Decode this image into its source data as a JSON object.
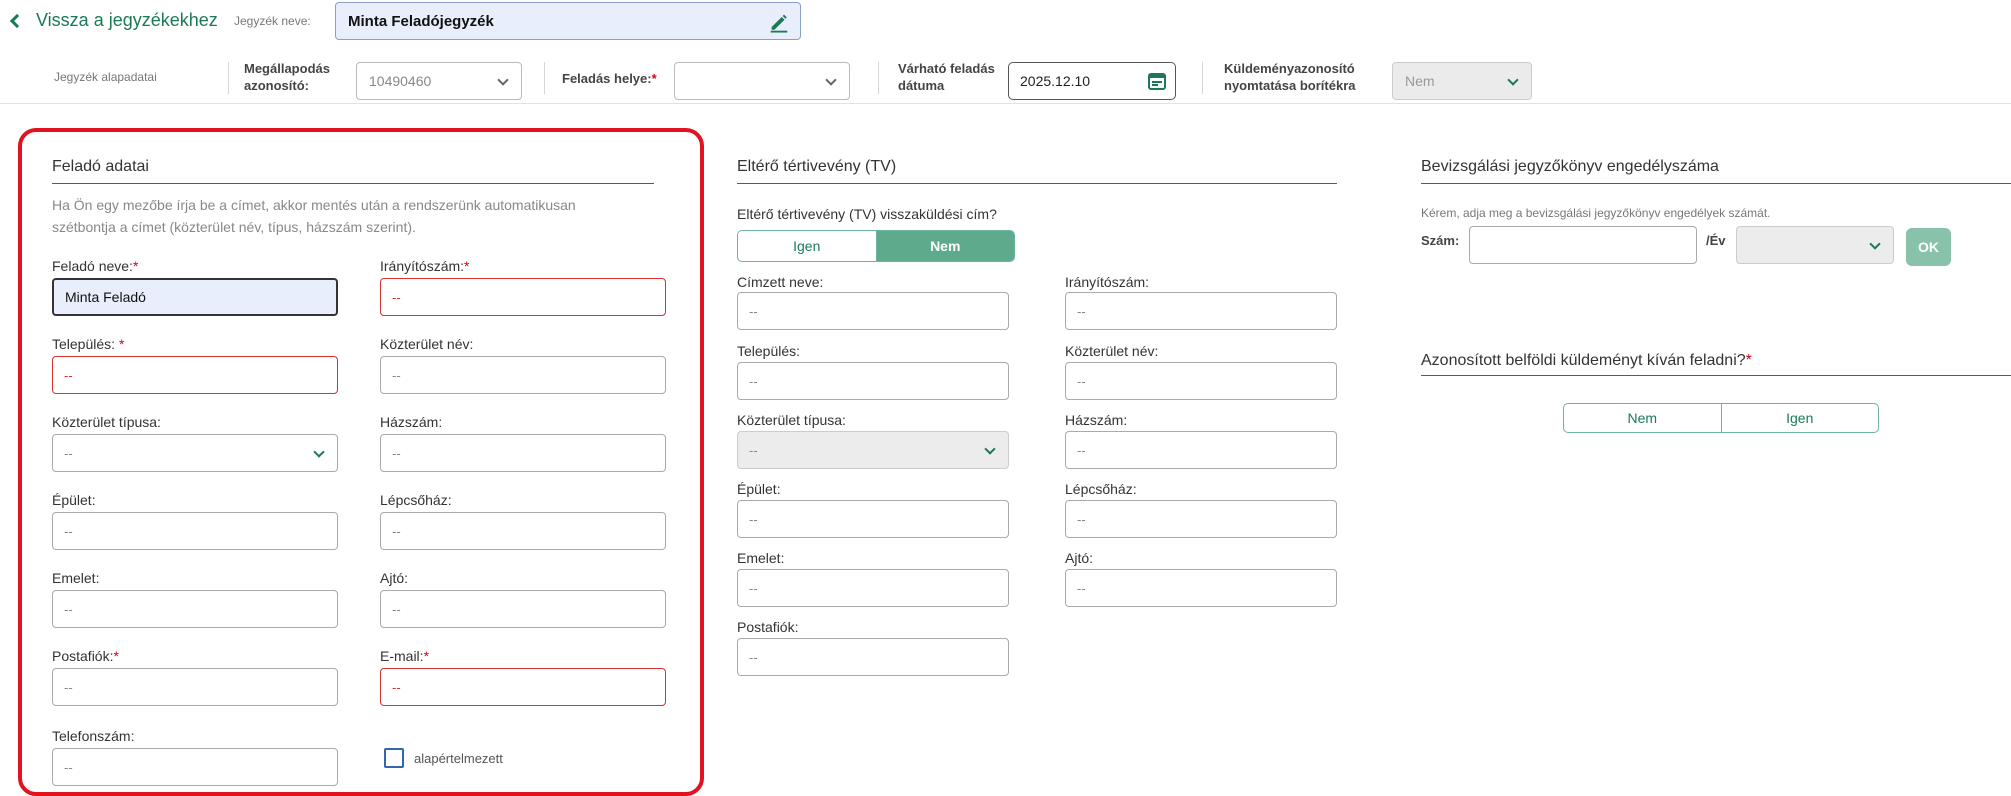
{
  "header": {
    "back_label": "Vissza a jegyzékekhez",
    "list_name_label": "Jegyzék neve:",
    "list_name_value": "Minta Feladójegyzék"
  },
  "toolbar": {
    "basic_data_label": "Jegyzék alapadatai",
    "agreement_label_1": "Megállapodás",
    "agreement_label_2": "azonosító:",
    "agreement_value": "10490460",
    "place_label": "Feladás helye:",
    "place_required": "*",
    "place_value": "",
    "date_label_1": "Várható feladás",
    "date_label_2": "dátuma",
    "date_value": "2025.12.10",
    "print_label_1": "Küldeményazonosító",
    "print_label_2": "nyomtatása borítékra",
    "print_value": "Nem"
  },
  "sender": {
    "title": "Feladó adatai",
    "hint_1": "Ha Ön egy mezőbe írja be a címet, akkor mentés után a rendszerünk automatikusan",
    "hint_2": "szétbontja a címet (közterület név, típus, házszám szerint).",
    "name_label": "Feladó neve:",
    "name_value": "Minta Feladó",
    "zip_label": "Irányítószám:",
    "zip_value": "--",
    "city_label": "Település: ",
    "city_value": "--",
    "street_label": "Közterület név:",
    "street_value": "--",
    "street_type_label": "Közterület típusa:",
    "street_type_value": "--",
    "house_label": "Házszám:",
    "house_value": "--",
    "building_label": "Épület:",
    "building_value": "--",
    "stair_label": "Lépcsőház:",
    "stair_value": "--",
    "floor_label": "Emelet:",
    "floor_value": "--",
    "door_label": "Ajtó:",
    "door_value": "--",
    "pobox_label": "Postafiók:",
    "pobox_value": "--",
    "email_label": "E-mail:",
    "email_value": "--",
    "phone_label": "Telefonszám:",
    "phone_value": "--",
    "default_label": "alapértelmezett",
    "required": "*"
  },
  "tv": {
    "title": "Eltérő tértivevény (TV)",
    "question": "Eltérő tértivevény (TV) visszaküldési cím?",
    "yes": "Igen",
    "no": "Nem",
    "recipient_label": "Címzett neve:",
    "recipient_value": "--",
    "zip_label": "Irányítószám:",
    "zip_value": "--",
    "city_label": "Település:",
    "city_value": "--",
    "street_label": "Közterület név:",
    "street_value": "--",
    "street_type_label": "Közterület típusa:",
    "street_type_value": "--",
    "house_label": "Házszám:",
    "house_value": "--",
    "building_label": "Épület:",
    "building_value": "--",
    "stair_label": "Lépcsőház:",
    "stair_value": "--",
    "floor_label": "Emelet:",
    "floor_value": "--",
    "door_label": "Ajtó:",
    "door_value": "--",
    "pobox_label": "Postafiók:",
    "pobox_value": "--"
  },
  "permit": {
    "title": "Bevizsgálási jegyzőkönyv engedélyszáma",
    "hint": "Kérem, adja meg a bevizsgálási jegyzőkönyv engedélyek számát.",
    "number_label": "Szám:",
    "year_label": "/Év",
    "ok": "OK"
  },
  "identified": {
    "title": "Azonosított belföldi küldeményt kíván feladni?",
    "required": "*",
    "no": "Nem",
    "yes": "Igen"
  }
}
